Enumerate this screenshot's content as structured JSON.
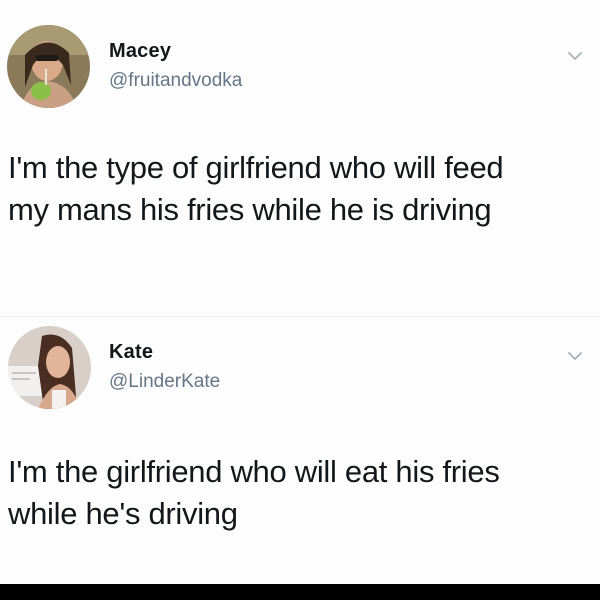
{
  "tweets": [
    {
      "display_name": "Macey",
      "handle": "@fruitandvodka",
      "text": "I'm the type of girlfriend who will feed\nmy mans his fries while he is driving",
      "menu_icon": "chevron-down-icon"
    },
    {
      "display_name": "Kate",
      "handle": "@LinderKate",
      "text": "I'm the girlfriend who will eat his fries\nwhile he's driving",
      "menu_icon": "chevron-down-icon"
    }
  ],
  "colors": {
    "text": "#14171a",
    "handle": "#657786",
    "chevron": "#a7b2bb",
    "background": "#fdfdfd"
  }
}
